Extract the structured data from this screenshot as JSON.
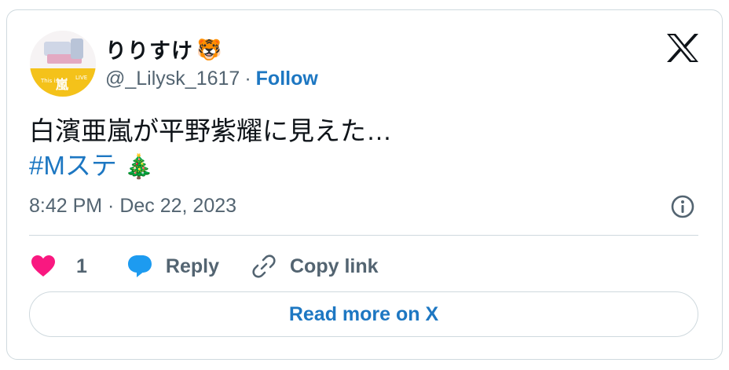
{
  "author": {
    "display_name": "りりすけ",
    "name_emoji": "🐯",
    "handle": "@_Lilysk_1617",
    "separator": "·",
    "follow_label": "Follow"
  },
  "tweet": {
    "text_line1": "白濱亜嵐が平野紫耀に見えた…",
    "hashtag": "#Mステ",
    "hashtag_emoji": "🎄",
    "timestamp": "8:42 PM · Dec 22, 2023"
  },
  "actions": {
    "like_count": "1",
    "reply_label": "Reply",
    "copy_link_label": "Copy link"
  },
  "footer": {
    "read_more_label": "Read more on X"
  },
  "icons": {
    "brand": "x-logo-icon",
    "info": "info-icon",
    "like": "heart-icon",
    "reply": "reply-bubble-icon",
    "copy": "link-icon"
  },
  "colors": {
    "link": "#1d77c2",
    "muted": "#536471",
    "like": "#f91880",
    "reply": "#1d9bf0",
    "border": "#cfd9de"
  }
}
